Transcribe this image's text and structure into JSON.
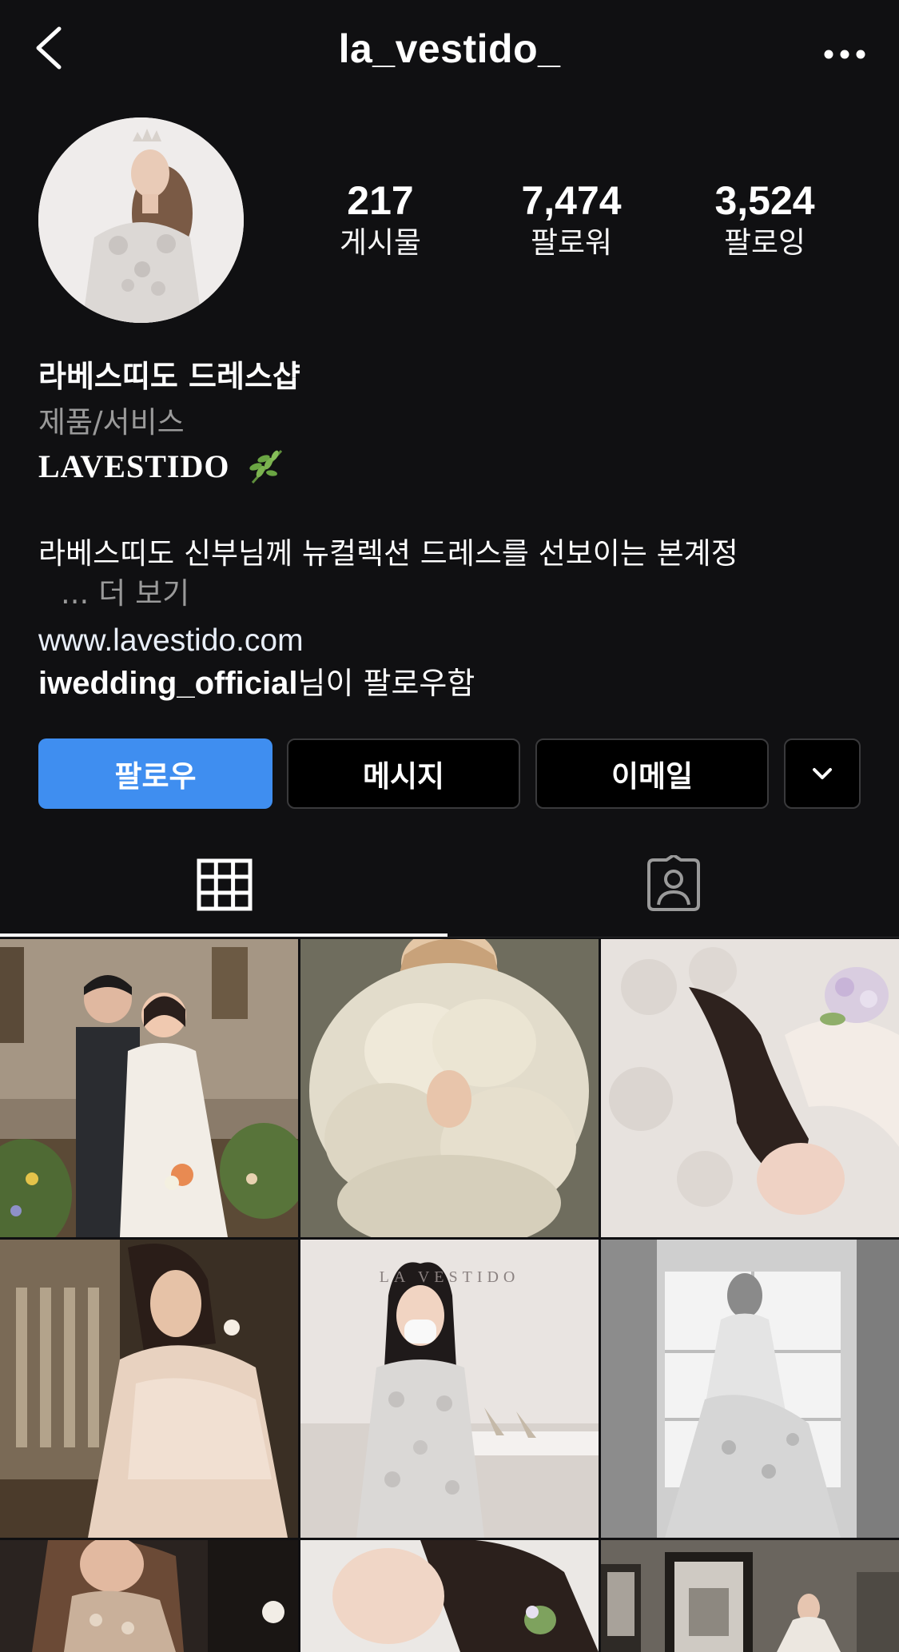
{
  "header": {
    "username": "la_vestido_",
    "back_icon": "chevron-left-icon",
    "more_icon": "more-horizontal-icon"
  },
  "stats": {
    "posts": {
      "value": "217",
      "label": "게시물"
    },
    "followers": {
      "value": "7,474",
      "label": "팔로워"
    },
    "following": {
      "value": "3,524",
      "label": "팔로잉"
    }
  },
  "bio": {
    "name": "라베스띠도 드레스샵",
    "category": "제품/서비스",
    "brand": "LAVESTIDO",
    "brand_emoji": "leaf-icon",
    "description": "라베스띠도 신부님께 뉴컬렉션 드레스를 선보이는 본계정",
    "more_dots": "...",
    "more_label": "더 보기",
    "link": "www.lavestido.com",
    "followed_by_user": "iwedding_official",
    "followed_by_suffix": "님이 팔로우함"
  },
  "actions": {
    "follow": "팔로우",
    "message": "메시지",
    "email": "이메일",
    "dropdown_icon": "chevron-down-icon"
  },
  "tabs": {
    "active": "grid",
    "grid_icon": "grid-icon",
    "tagged_icon": "tagged-person-icon"
  },
  "posts": {
    "watermark": "LA VESTIDO"
  },
  "colors": {
    "background": "#101012",
    "follow_button": "#3f8ef0",
    "secondary_text": "#9a9a9a"
  }
}
